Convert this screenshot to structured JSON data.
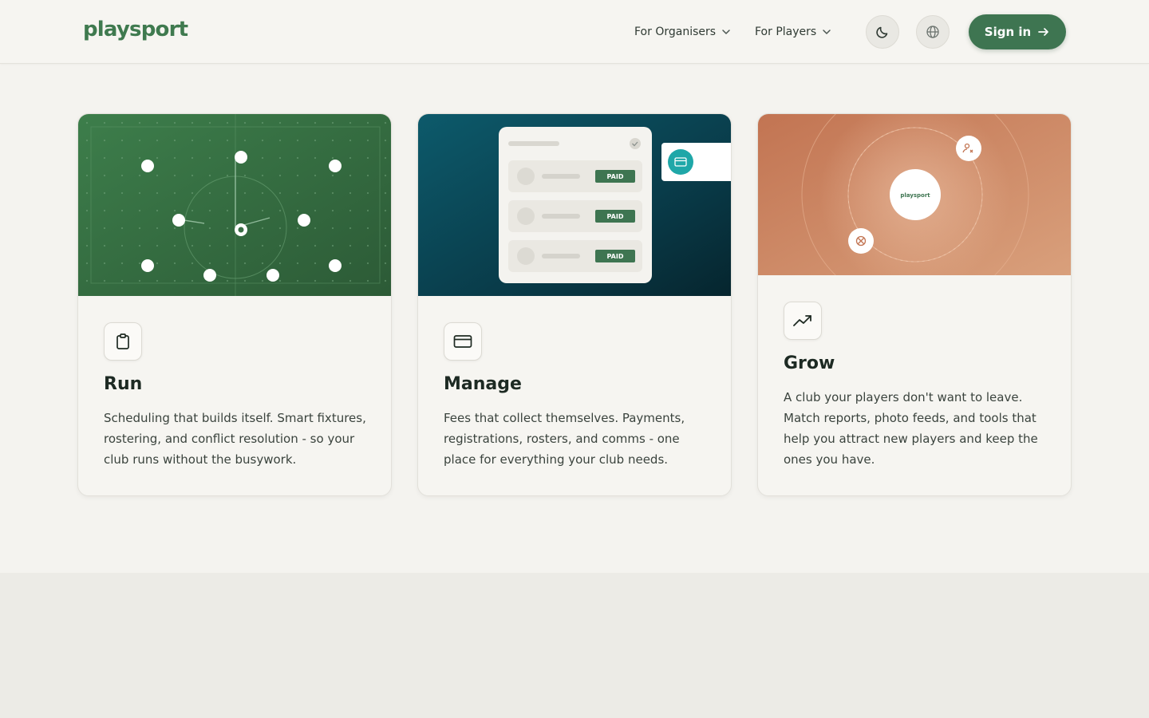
{
  "header": {
    "logo": "playsport",
    "nav": [
      {
        "label": "For Organisers"
      },
      {
        "label": "For Players"
      }
    ],
    "signin_label": "Sign in"
  },
  "cards": [
    {
      "title": "Run",
      "text": "Scheduling that builds itself. Smart fixtures, rostering, and conflict resolution - so your club runs without the busywork.",
      "icon": "clipboard-icon"
    },
    {
      "title": "Manage",
      "text": "Fees that collect themselves. Payments, registrations, rosters, and comms - one place for everything your club needs.",
      "icon": "credit-card-icon",
      "badges": [
        "PAID",
        "PAID",
        "PAID"
      ]
    },
    {
      "title": "Grow",
      "text": "A club your players don't want to leave. Match reports, photo feeds, and tools that help you attract new players and keep the ones you have.",
      "icon": "trending-up-icon",
      "center_logo": "playsport"
    }
  ],
  "colors": {
    "brand_green": "#3e7551",
    "run_bg": "#3a7a48",
    "manage_bg": "#0b4a5a",
    "grow_bg": "#cc8460",
    "page_bg": "#f4f3ef"
  }
}
